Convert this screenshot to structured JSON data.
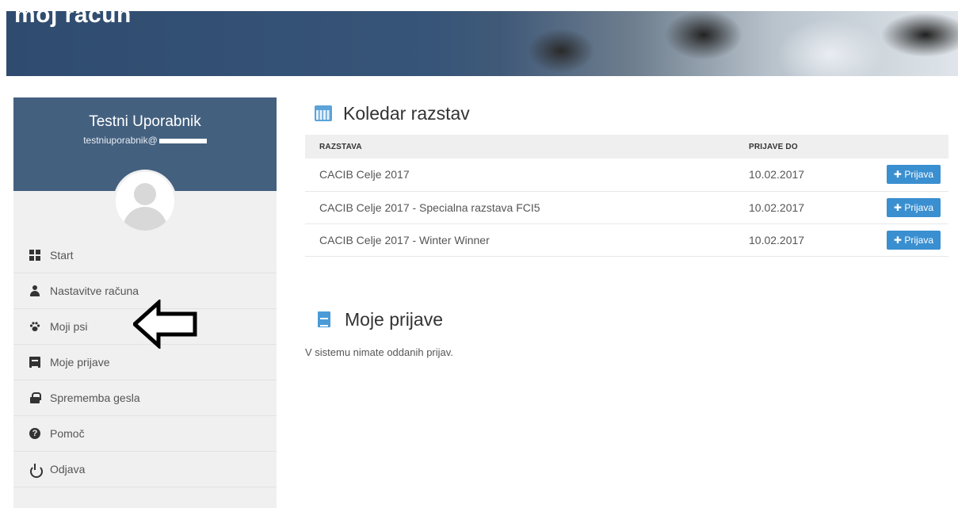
{
  "banner": {
    "title": "moj račun"
  },
  "profile": {
    "name": "Testni Uporabnik",
    "email": "testniuporabnik@"
  },
  "menu": [
    {
      "label": "Start",
      "icon": "windows-icon"
    },
    {
      "label": "Nastavitve računa",
      "icon": "user-icon"
    },
    {
      "label": "Moji psi",
      "icon": "paw-icon"
    },
    {
      "label": "Moje prijave",
      "icon": "document-icon"
    },
    {
      "label": "Sprememba gesla",
      "icon": "lock-icon"
    },
    {
      "label": "Pomoč",
      "icon": "help-icon",
      "glyph": "?"
    },
    {
      "label": "Odjava",
      "icon": "power-icon"
    }
  ],
  "calendar": {
    "title": "Koledar razstav",
    "columns": [
      "RAZSTAVA",
      "PRIJAVE DO"
    ],
    "rows": [
      {
        "show": "CACIB Celje 2017",
        "deadline": "10.02.2017",
        "action": "Prijava"
      },
      {
        "show": "CACIB Celje 2017 - Specialna razstava FCI5",
        "deadline": "10.02.2017",
        "action": "Prijava"
      },
      {
        "show": "CACIB Celje 2017 - Winter Winner",
        "deadline": "10.02.2017",
        "action": "Prijava"
      }
    ]
  },
  "registrations": {
    "title": "Moje prijave",
    "empty_text": "V sistemu nimate oddanih prijav."
  },
  "colors": {
    "banner": "#375578",
    "profile_header": "#44607f",
    "sidebar_bg": "#f0f0f0",
    "button": "#3a8fd0"
  }
}
